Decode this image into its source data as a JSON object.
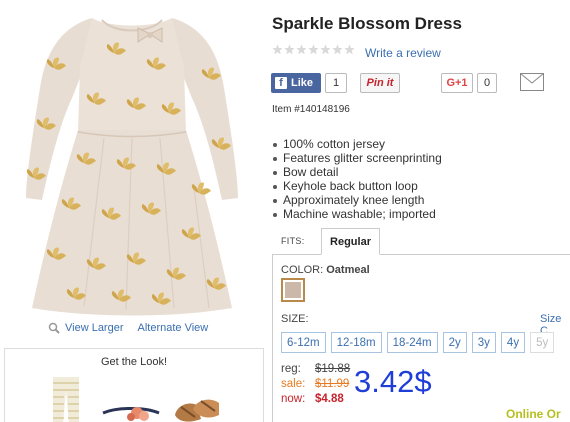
{
  "product": {
    "title": "Sparkle Blossom Dress",
    "rating_stars": 5,
    "review_link": "Write a review",
    "item_number": "Item #140148196",
    "features": [
      "100% cotton jersey",
      "Features glitter screenprinting",
      "Bow detail",
      "Keyhole back button loop",
      "Approximately knee length",
      "Machine washable; imported"
    ]
  },
  "image_links": {
    "view_larger": "View Larger",
    "alternate_view": "Alternate View",
    "magnifier_icon": "magnifier-icon"
  },
  "get_the_look": {
    "title": "Get the Look!"
  },
  "social": {
    "fb_label": "Like",
    "fb_count": "1",
    "pin_label": "Pin it",
    "gplus_label": "G+1",
    "gplus_count": "0",
    "mail_icon": "envelope-icon"
  },
  "fits": {
    "label": "FITS:",
    "active_tab": "Regular"
  },
  "color": {
    "label": "COLOR:",
    "value": "Oatmeal",
    "swatch_color": "#cbb8a8"
  },
  "size": {
    "label": "SIZE:",
    "chart_link": "Size C",
    "options": [
      {
        "label": "6-12m",
        "available": true
      },
      {
        "label": "12-18m",
        "available": true
      },
      {
        "label": "18-24m",
        "available": true
      },
      {
        "label": "2y",
        "available": true
      },
      {
        "label": "3y",
        "available": true
      },
      {
        "label": "4y",
        "available": true
      },
      {
        "label": "5y",
        "available": false
      }
    ]
  },
  "prices": {
    "reg_label": "reg:",
    "reg_value": "$19.88",
    "sale_label": "sale:",
    "sale_value": "$11.99",
    "now_label": "now:",
    "now_value": "$4.88"
  },
  "overlay_price": "3.42$",
  "online_label": "Online Or"
}
